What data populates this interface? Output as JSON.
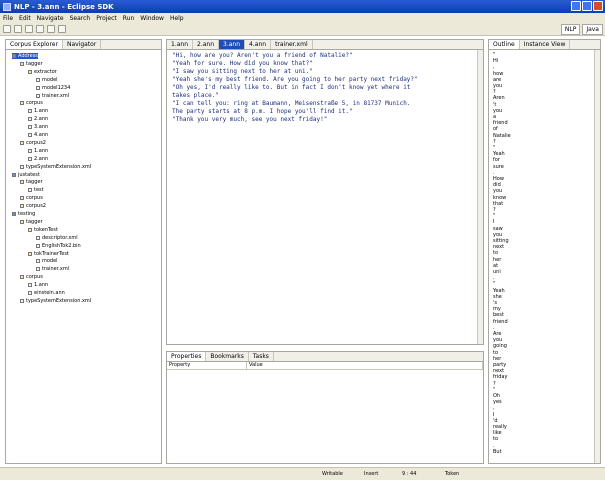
{
  "window": {
    "title": "NLP - 3.ann - Eclipse SDK"
  },
  "menu": [
    "File",
    "Edit",
    "Navigate",
    "Search",
    "Project",
    "Run",
    "Window",
    "Help"
  ],
  "perspectives": [
    "NLP",
    "Java"
  ],
  "left_panel": {
    "tabs": [
      "Corpus Explorer",
      "Navigator"
    ],
    "tree": [
      {
        "label": "Address",
        "level": 0,
        "type": "proj",
        "selected": true
      },
      {
        "label": "tagger",
        "level": 1,
        "type": "folder"
      },
      {
        "label": "extractor",
        "level": 2,
        "type": "folder"
      },
      {
        "label": "model",
        "level": 3,
        "type": "file"
      },
      {
        "label": "model1234",
        "level": 3,
        "type": "file"
      },
      {
        "label": "trainer.xml",
        "level": 3,
        "type": "file"
      },
      {
        "label": "corpus",
        "level": 1,
        "type": "folder"
      },
      {
        "label": "1.ann",
        "level": 2,
        "type": "file"
      },
      {
        "label": "2.ann",
        "level": 2,
        "type": "file"
      },
      {
        "label": "3.ann",
        "level": 2,
        "type": "file"
      },
      {
        "label": "4.ann",
        "level": 2,
        "type": "file"
      },
      {
        "label": "corpus2",
        "level": 1,
        "type": "folder"
      },
      {
        "label": "1.ann",
        "level": 2,
        "type": "file"
      },
      {
        "label": "2.ann",
        "level": 2,
        "type": "file"
      },
      {
        "label": "typeSystemExtension.xml",
        "level": 1,
        "type": "file"
      },
      {
        "label": "justatest",
        "level": 0,
        "type": "proj"
      },
      {
        "label": "tagger",
        "level": 1,
        "type": "folder"
      },
      {
        "label": "test",
        "level": 2,
        "type": "file"
      },
      {
        "label": "corpus",
        "level": 1,
        "type": "folder"
      },
      {
        "label": "corpus2",
        "level": 1,
        "type": "folder"
      },
      {
        "label": "testing",
        "level": 0,
        "type": "proj"
      },
      {
        "label": "tagger",
        "level": 1,
        "type": "folder"
      },
      {
        "label": "tokenTest",
        "level": 2,
        "type": "folder"
      },
      {
        "label": "descriptor.xml",
        "level": 3,
        "type": "file"
      },
      {
        "label": "EnglishTok2.bin",
        "level": 3,
        "type": "file"
      },
      {
        "label": "tokTrainerTest",
        "level": 2,
        "type": "folder"
      },
      {
        "label": "model",
        "level": 3,
        "type": "file"
      },
      {
        "label": "trainer.xml",
        "level": 3,
        "type": "file"
      },
      {
        "label": "corpus",
        "level": 1,
        "type": "folder"
      },
      {
        "label": "1.ann",
        "level": 2,
        "type": "file"
      },
      {
        "label": "einstein.ann",
        "level": 2,
        "type": "file"
      },
      {
        "label": "typeSystemExtension.xml",
        "level": 1,
        "type": "file"
      }
    ]
  },
  "editor": {
    "tabs": [
      "1.ann",
      "2.ann",
      "3.ann",
      "4.ann",
      "trainer.xml"
    ],
    "active_tab": 2,
    "lines": [
      "\"Hi, how are you? Aren't you a friend of Natalie?\"",
      "\"Yeah for sure. How did you know that?\"",
      "\"I saw you sitting next to her at uni.\"",
      "\"Yeah she's my best friend. Are you going to her party next friday?\"",
      "\"Oh yes, I'd really like to. But in fact I don't know yet where it",
      "takes place.\"",
      "\"I can tell you: ring at Baumann, Meisenstraße 5, in 81737 Munich.",
      "The party starts at  8 p.m. I hope you'll find it.\"",
      "\"Thank you very much, see you next friday!\""
    ]
  },
  "properties": {
    "tabs": [
      "Properties",
      "Bookmarks",
      "Tasks"
    ],
    "columns": [
      "Property",
      "Value"
    ]
  },
  "outline": {
    "tabs": [
      "Outline",
      "Instance View"
    ],
    "tokens": [
      "\"",
      "Hi",
      ",",
      "how",
      "are",
      "you",
      "?",
      "Aren",
      "'t",
      "you",
      "a",
      "friend",
      "of",
      "Natalie",
      "?",
      "\"",
      "Yeah",
      "for",
      "sure",
      ".",
      "How",
      "did",
      "you",
      "know",
      "that",
      "?",
      "\"",
      "I",
      "saw",
      "you",
      "sitting",
      "next",
      "to",
      "her",
      "at",
      "uni",
      ".",
      "\"",
      "Yeah",
      "she",
      "'s",
      "my",
      "best",
      "friend",
      ".",
      "Are",
      "you",
      "going",
      "to",
      "her",
      "party",
      "next",
      "friday",
      "?",
      "\"",
      "Oh",
      "yes",
      ",",
      "I",
      "'d",
      "really",
      "like",
      "to",
      ".",
      "But"
    ]
  },
  "status": {
    "writable": "Writable",
    "insert": "Insert",
    "position": "9 : 44",
    "token": "Token"
  }
}
